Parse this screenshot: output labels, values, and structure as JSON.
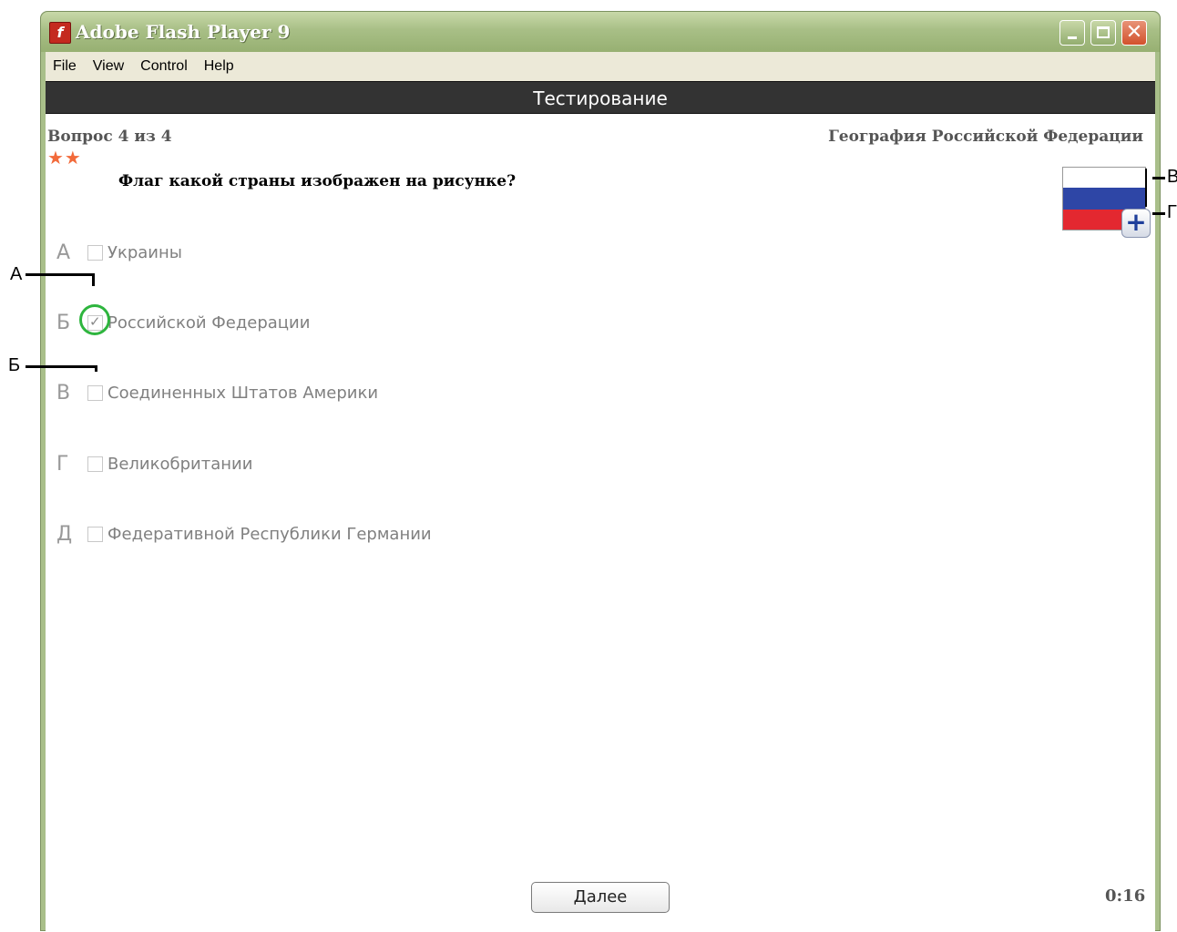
{
  "window": {
    "title": "Adobe Flash Player 9"
  },
  "menu": [
    "File",
    "View",
    "Control",
    "Help"
  ],
  "header": "Тестирование",
  "quiz": {
    "counter": "Вопрос 4 из 4",
    "subject": "География Российской Федерации",
    "stars": "★★",
    "question": "Флаг какой страны изображен на рисунке?",
    "answers": [
      {
        "letter": "А",
        "label": "Украины",
        "checked": false
      },
      {
        "letter": "Б",
        "label": "Российской Федерации",
        "checked": true
      },
      {
        "letter": "В",
        "label": "Соединенных Штатов Америки",
        "checked": false
      },
      {
        "letter": "Г",
        "label": "Великобритании",
        "checked": false
      },
      {
        "letter": "Д",
        "label": "Федеративной Республики Германии",
        "checked": false
      }
    ],
    "next_label": "Далее",
    "timer": "0:16"
  },
  "annotations": {
    "a": "А",
    "b": "Б",
    "v": "В",
    "g": "Г"
  },
  "colors": {
    "highlight": "#2eb53e",
    "stars": "#f26a3a",
    "flag_white": "#ffffff",
    "flag_blue": "#2e46a6",
    "flag_red": "#e32830"
  },
  "icons": {
    "app": "flash-icon",
    "zoom": "plus-icon"
  }
}
